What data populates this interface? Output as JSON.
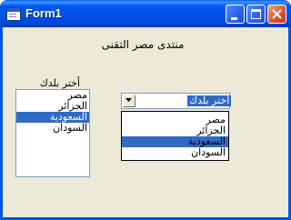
{
  "window": {
    "title": "Form1",
    "accent": "#0054e3",
    "background": "#ece9d8",
    "controls": [
      "minimize-icon",
      "maximize-icon",
      "close-icon"
    ]
  },
  "heading": "منتدى مصر التقنى",
  "listbox": {
    "label": "أختر بلدك",
    "items": [
      "مصر",
      "الجزائر",
      "السعودية",
      "السودان"
    ],
    "selected_index": 2
  },
  "combobox": {
    "value": "أختر بلدك",
    "options": [
      "مصر",
      "الجزائر",
      "السعودية",
      "السودان"
    ],
    "highlighted_index": 2,
    "arrow_icon": "chevron-down-icon"
  },
  "selection_color": "#316ac5"
}
